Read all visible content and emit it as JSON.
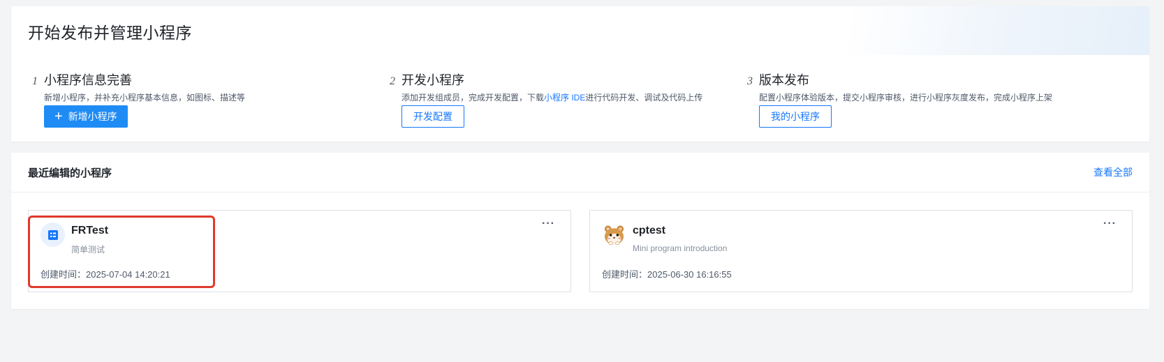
{
  "header": {
    "title": "开始发布并管理小程序"
  },
  "steps": [
    {
      "num": "1",
      "title": "小程序信息完善",
      "desc": "新增小程序，并补充小程序基本信息，如图标、描述等",
      "button": "新增小程序",
      "button_icon": "plus-icon"
    },
    {
      "num": "2",
      "title": "开发小程序",
      "desc_before": "添加开发组成员，完成开发配置，下载",
      "desc_link": "小程序 IDE",
      "desc_after": "进行代码开发、调试及代码上传",
      "button": "开发配置"
    },
    {
      "num": "3",
      "title": "版本发布",
      "desc": "配置小程序体验版本，提交小程序审核，进行小程序灰度发布，完成小程序上架",
      "button": "我的小程序"
    }
  ],
  "recent": {
    "title": "最近编辑的小程序",
    "view_all": "查看全部",
    "more_label": "···",
    "apps": [
      {
        "name": "FRTest",
        "desc": "简单测试",
        "time": "创建时间：2025-07-04 14:20:21",
        "icon": "app-grid-icon",
        "highlighted": true
      },
      {
        "name": "cptest",
        "desc": "Mini program introduction",
        "time": "创建时间：2025-06-30 16:16:55",
        "icon": "hamster-avatar-icon"
      }
    ]
  },
  "colors": {
    "accent": "#1677ff",
    "primary_button": "#1f8cf5",
    "highlight": "#e0392b",
    "background": "#f3f4f6"
  }
}
